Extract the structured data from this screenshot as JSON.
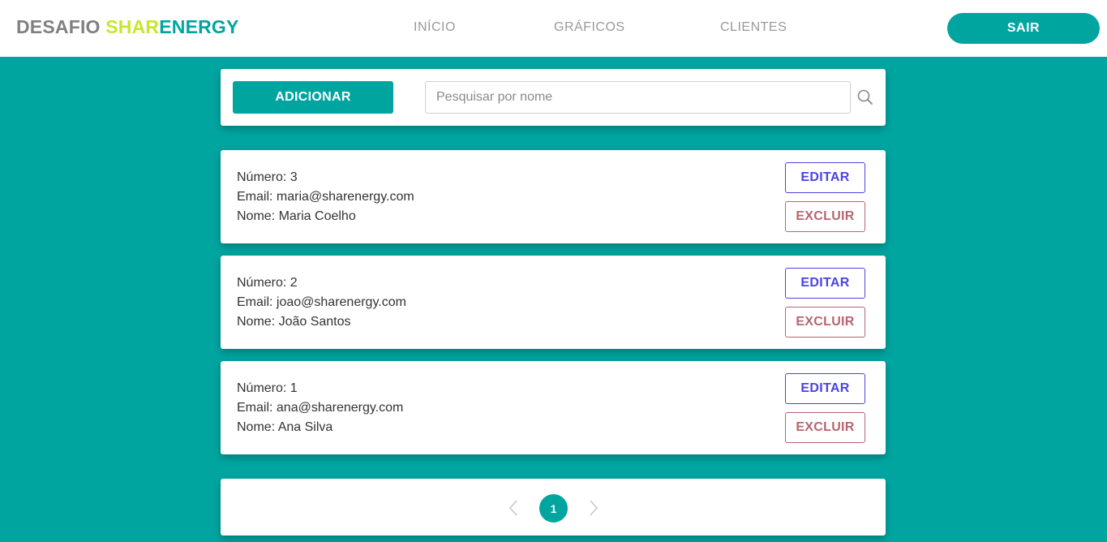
{
  "header": {
    "logo": {
      "part1": "DESAFIO ",
      "part2": "SHAR",
      "part3": "ENERGY"
    },
    "nav": [
      {
        "label": "INÍCIO"
      },
      {
        "label": "GRÁFICOS"
      },
      {
        "label": "CLIENTES"
      }
    ],
    "logout_label": "SAIR"
  },
  "toolbar": {
    "add_label": "ADICIONAR",
    "search_placeholder": "Pesquisar por nome",
    "search_value": "",
    "search_icon": "search-icon"
  },
  "clients": [
    {
      "number": "Número: 3",
      "email": "Email: maria@sharenergy.com",
      "name": "Nome: Maria Coelho",
      "edit_label": "EDITAR",
      "delete_label": "EXCLUIR"
    },
    {
      "number": "Número: 2",
      "email": "Email: joao@sharenergy.com",
      "name": "Nome: João Santos",
      "edit_label": "EDITAR",
      "delete_label": "EXCLUIR"
    },
    {
      "number": "Número: 1",
      "email": "Email: ana@sharenergy.com",
      "name": "Nome: Ana Silva",
      "edit_label": "EDITAR",
      "delete_label": "EXCLUIR"
    }
  ],
  "pagination": {
    "current_page": "1",
    "prev_icon": "chevron-left-icon",
    "next_icon": "chevron-right-icon"
  },
  "colors": {
    "accent": "#00a5a0",
    "logo_green": "#c8e62c",
    "logo_gray": "#808080",
    "edit": "#4b44e0",
    "delete": "#b5666f"
  }
}
